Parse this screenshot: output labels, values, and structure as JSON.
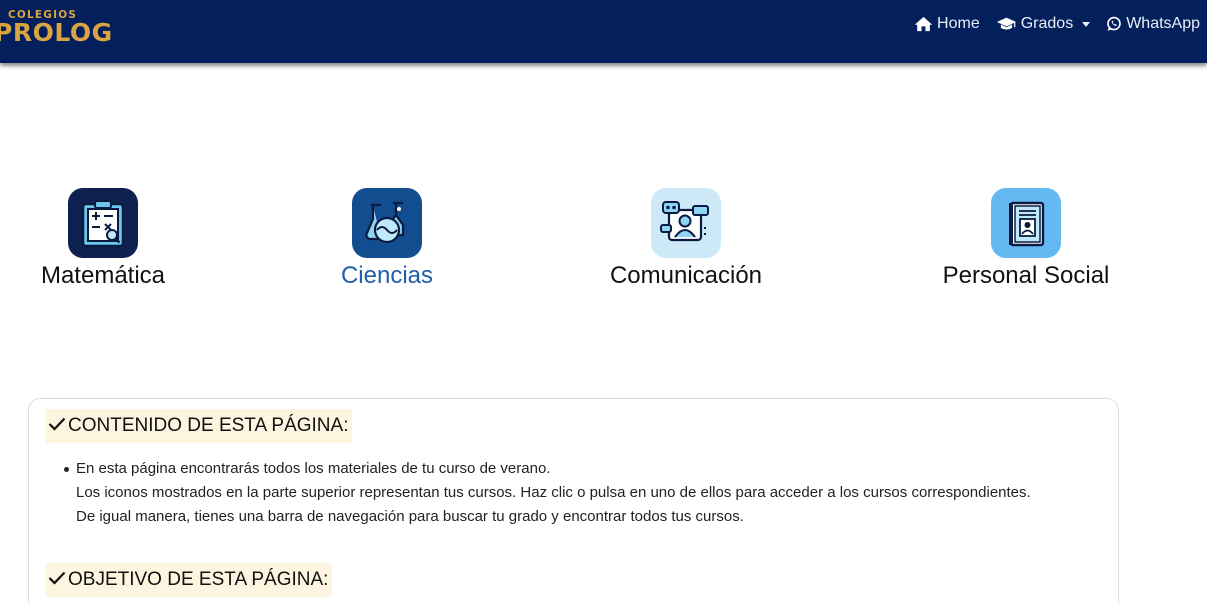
{
  "brand": {
    "small": "COLEGIOS",
    "big": "PROLOG",
    "color": "#d9a441"
  },
  "navbar": {
    "background": "#03205c",
    "items": [
      {
        "label": "Home",
        "icon": "home-icon"
      },
      {
        "label": "Grados",
        "icon": "graduation-cap-icon",
        "dropdown": true
      },
      {
        "label": "WhatsApp",
        "icon": "whatsapp-icon"
      }
    ]
  },
  "courses": [
    {
      "label": "Matemática",
      "icon": "math-clipboard-icon",
      "icon_bg": "#0f2150",
      "active": false
    },
    {
      "label": "Ciencias",
      "icon": "science-flasks-icon",
      "icon_bg": "#124d90",
      "active": true
    },
    {
      "label": "Comunicación",
      "icon": "communication-icon",
      "icon_bg": "#cde9f8",
      "active": false
    },
    {
      "label": "Personal Social",
      "icon": "profile-book-icon",
      "icon_bg": "#64b9f3",
      "active": false
    }
  ],
  "content": {
    "heading1": "CONTENIDO DE ESTA PÁGINA:",
    "bullets": [
      "En esta página encontrarás todos los materiales de tu curso de verano.",
      "Los iconos mostrados en la parte superior representan tus cursos. Haz clic o pulsa en uno de ellos para acceder a los cursos correspondientes.",
      "De igual manera, tienes una barra de navegación para buscar tu grado y encontrar todos tus cursos."
    ],
    "heading2": "OBJETIVO DE ESTA PÁGINA:"
  }
}
